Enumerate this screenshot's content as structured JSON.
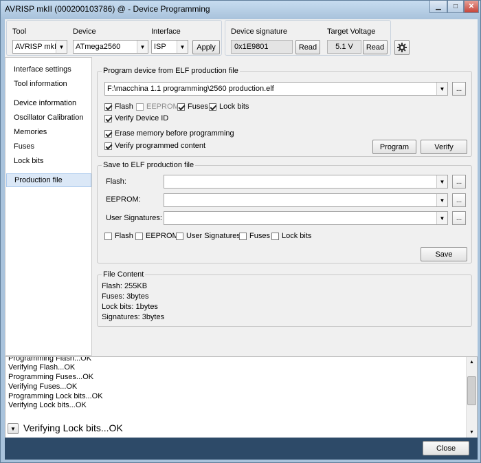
{
  "window": {
    "title": "AVRISP mkII (000200103786) @  - Device Programming"
  },
  "toolbar": {
    "tool_label": "Tool",
    "tool_value": "AVRISP mkII",
    "device_label": "Device",
    "device_value": "ATmega2560",
    "interface_label": "Interface",
    "interface_value": "ISP",
    "apply_label": "Apply",
    "signature_label": "Device signature",
    "signature_value": "0x1E9801",
    "signature_read_label": "Read",
    "voltage_label": "Target Voltage",
    "voltage_value": "5.1 V",
    "voltage_read_label": "Read"
  },
  "sidebar": {
    "items": [
      {
        "label": "Interface settings"
      },
      {
        "label": "Tool information"
      },
      {
        "label": "Device information"
      },
      {
        "label": "Oscillator Calibration"
      },
      {
        "label": "Memories"
      },
      {
        "label": "Fuses"
      },
      {
        "label": "Lock bits"
      },
      {
        "label": "Production file"
      }
    ]
  },
  "program_section": {
    "legend": "Program device from ELF production file",
    "file_path": "F:\\macchina 1.1 programming\\2560 production.elf",
    "browse_label": "...",
    "flash_label": "Flash",
    "eeprom_label": "EEPROM",
    "fuses_label": "Fuses",
    "lockbits_label": "Lock bits",
    "verify_id_label": "Verify Device ID",
    "erase_label": "Erase memory before programming",
    "verify_content_label": "Verify programmed content",
    "program_button": "Program",
    "verify_button": "Verify"
  },
  "save_section": {
    "legend": "Save to ELF production file",
    "flash_label": "Flash:",
    "eeprom_label": "EEPROM:",
    "user_sig_label": "User Signatures:",
    "browse_label": "...",
    "cb_flash": "Flash",
    "cb_eeprom": "EEPROM",
    "cb_user_sig": "User Signatures",
    "cb_fuses": "Fuses",
    "cb_lockbits": "Lock bits",
    "save_button": "Save"
  },
  "file_content": {
    "legend": "File Content",
    "lines": [
      "Flash: 255KB",
      "Fuses: 3bytes",
      "Lock bits: 1bytes",
      "Signatures: 3bytes"
    ]
  },
  "log": {
    "lines": [
      "Programming Flash...OK",
      "Verifying Flash...OK",
      "Programming Fuses...OK",
      "Verifying Fuses...OK",
      "Programming Lock bits...OK",
      "Verifying Lock bits...OK"
    ]
  },
  "status": {
    "text": "Verifying Lock bits...OK"
  },
  "footer": {
    "close_label": "Close"
  }
}
